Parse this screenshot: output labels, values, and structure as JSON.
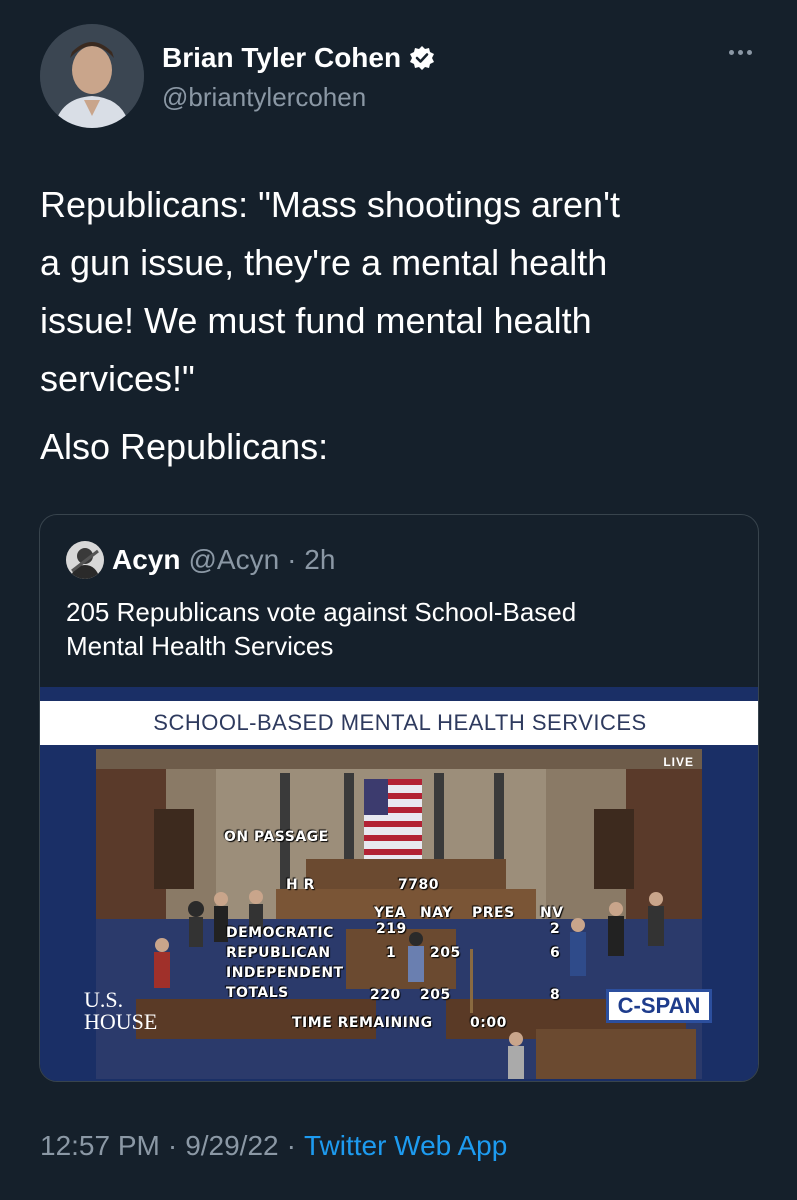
{
  "author": {
    "name": "Brian Tyler Cohen",
    "handle": "@briantylercohen",
    "verified": true
  },
  "tweet": {
    "text": "Republicans: \"Mass shootings aren't\na gun issue, they're a mental health\nissue! We must fund mental health\nservices!\"",
    "text2": "Also Republicans:"
  },
  "quote": {
    "name": "Acyn",
    "handle": "@Acyn",
    "time": "· 2h",
    "text": "205 Republicans vote against School-Based\nMental Health Services",
    "media": {
      "banner": "SCHOOL-BASED MENTAL HEALTH SERVICES",
      "live": "LIVE",
      "on_passage": "ON PASSAGE",
      "bill_prefix": "H R",
      "bill_number": "7780",
      "col_yea": "YEA",
      "col_nay": "NAY",
      "col_pres": "PRES",
      "col_nv": "NV",
      "row_dem": "DEMOCRATIC",
      "row_rep": "REPUBLICAN",
      "row_ind": "INDEPENDENT",
      "row_tot": "TOTALS",
      "dem_yea": "219",
      "dem_nv": "2",
      "rep_yea": "1",
      "rep_nay": "205",
      "rep_nv": "6",
      "tot_yea": "220",
      "tot_nay": "205",
      "tot_nv": "8",
      "time_remaining_label": "TIME REMAINING",
      "time_remaining_value": "0:00",
      "house_logo_line1": "U.S.",
      "house_logo_line2": "HOUSE",
      "network_logo": "C-SPAN"
    }
  },
  "footer": {
    "time": "12:57 PM",
    "sep1": "·",
    "date": "9/29/22",
    "sep2": "·",
    "source": "Twitter Web App"
  },
  "colors": {
    "background": "#15202b",
    "secondary_text": "#8b98a5",
    "link": "#1d9bf0",
    "verified_badge": "#ffffff"
  }
}
